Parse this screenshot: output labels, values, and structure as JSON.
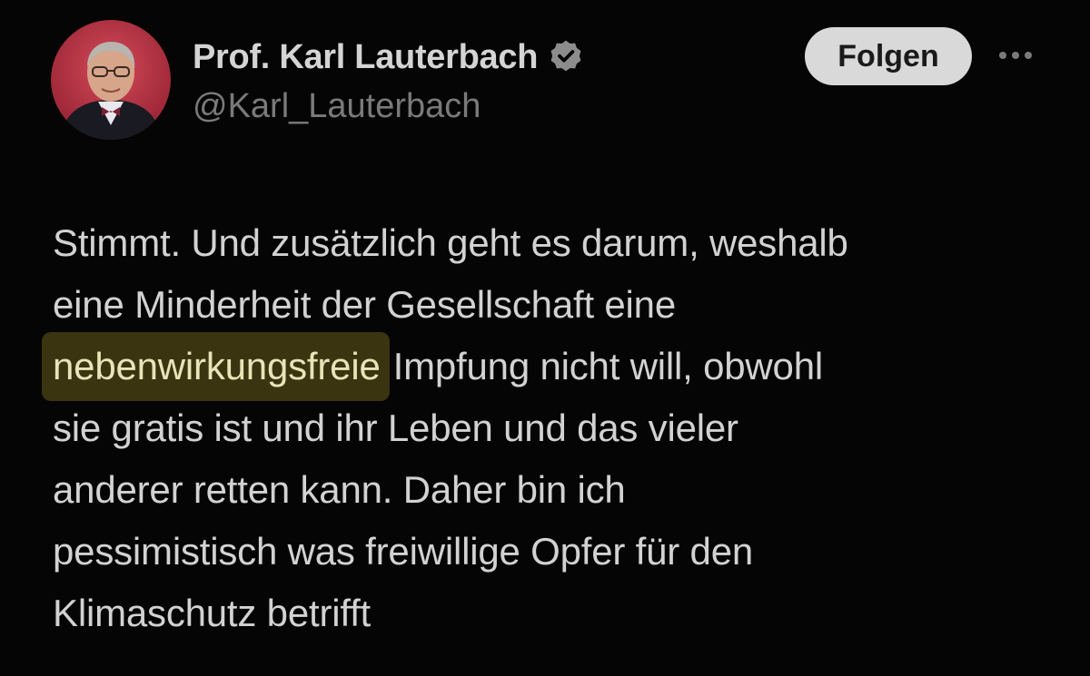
{
  "author": {
    "name": "Prof. Karl Lauterbach",
    "handle": "@Karl_Lauterbach",
    "avatar_icon": "profile-photo",
    "verified_icon": "verified-badge-icon"
  },
  "actions": {
    "follow_label": "Folgen",
    "more_icon": "more-options-icon"
  },
  "tweet": {
    "lines": [
      {
        "text": "Stimmt. Und zusätzlich geht es darum, weshalb"
      },
      {
        "text": "eine Minderheit der Gesellschaft eine"
      },
      {
        "highlight": "nebenwirkungsfreie",
        "rest": "Impfung nicht will, obwohl"
      },
      {
        "text": "sie gratis ist und ihr Leben und das vieler"
      },
      {
        "text": "anderer retten kann. Daher bin ich"
      },
      {
        "text": "pessimistisch was freiwillige Opfer für den"
      },
      {
        "text": "Klimaschutz betrifft"
      }
    ]
  },
  "colors": {
    "background": "#050505",
    "text": "#d2d2d2",
    "handle": "#7a7a7a",
    "highlight_bg": "#3a3410",
    "follow_bg": "#d9d9d9"
  }
}
